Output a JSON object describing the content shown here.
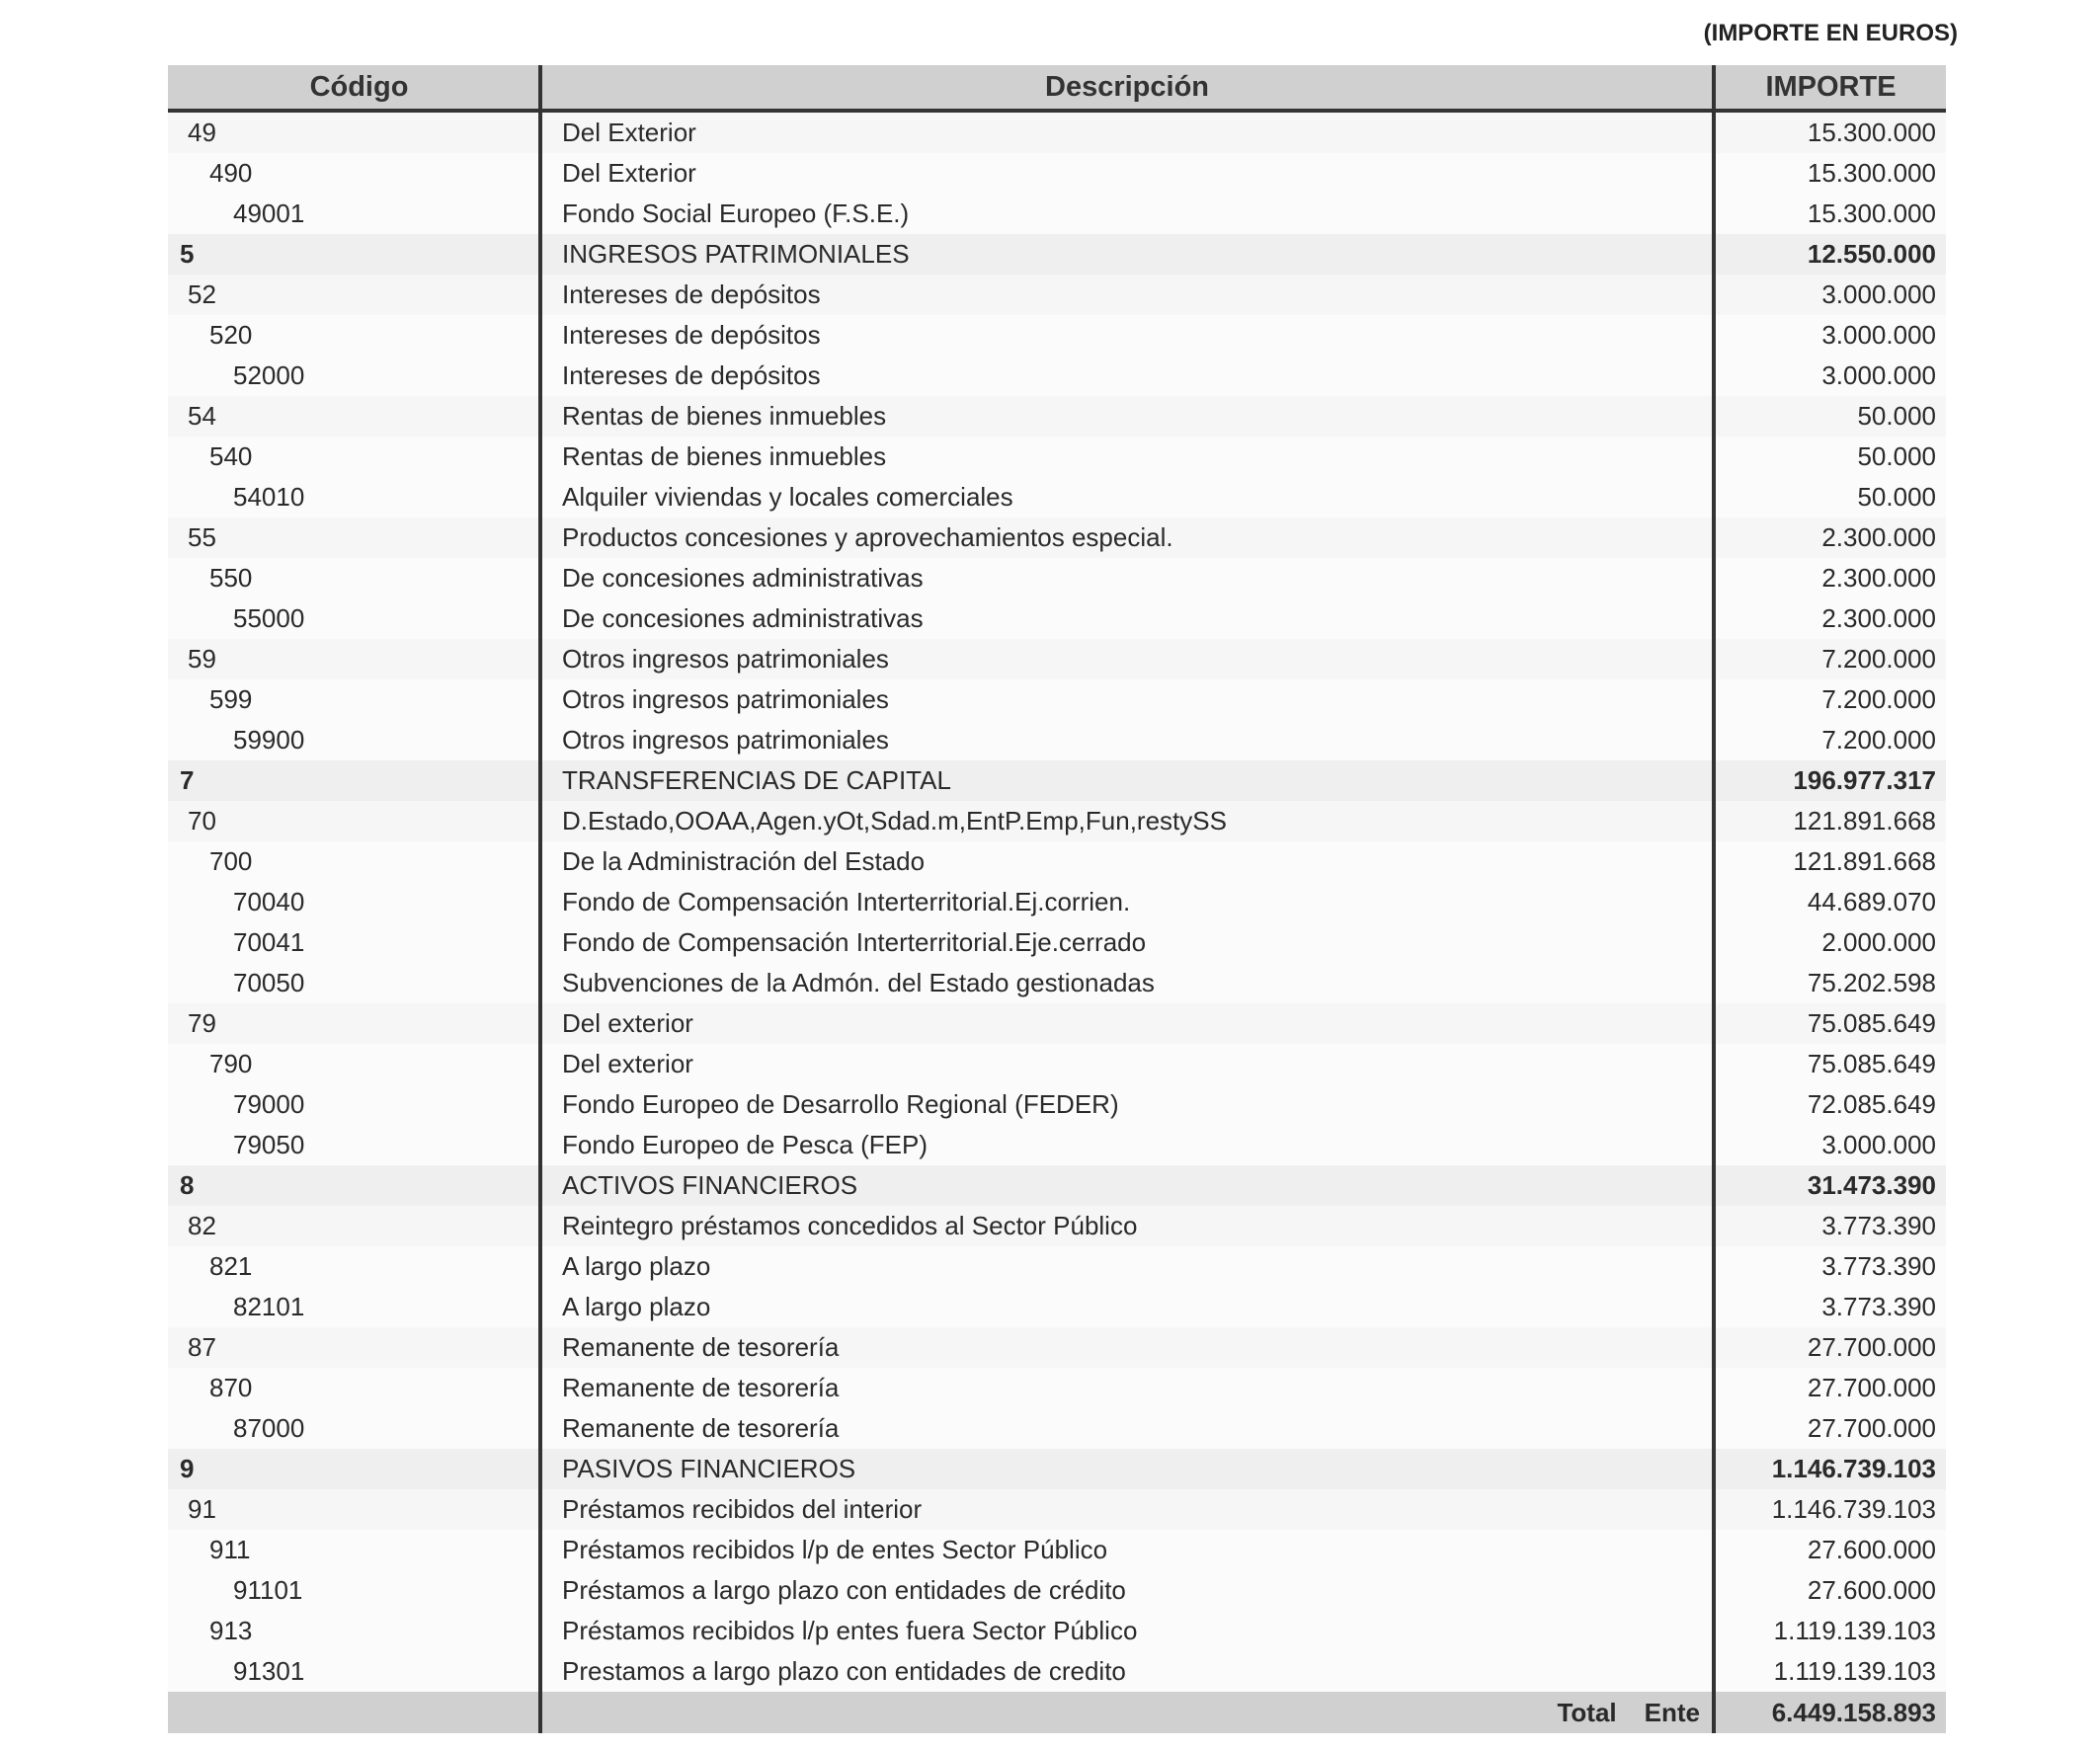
{
  "units_label": "(IMPORTE EN EUROS)",
  "columns": {
    "code": "Código",
    "description": "Descripción",
    "amount": "IMPORTE"
  },
  "rows": [
    {
      "level": 2,
      "code": "49",
      "description": "Del Exterior",
      "amount": "15.300.000"
    },
    {
      "level": 3,
      "code": "490",
      "description": "Del Exterior",
      "amount": "15.300.000"
    },
    {
      "level": 4,
      "code": "49001",
      "description": "Fondo Social Europeo (F.S.E.)",
      "amount": "15.300.000"
    },
    {
      "level": 1,
      "code": "5",
      "description": "INGRESOS PATRIMONIALES",
      "amount": "12.550.000"
    },
    {
      "level": 2,
      "code": "52",
      "description": "Intereses de depósitos",
      "amount": "3.000.000"
    },
    {
      "level": 3,
      "code": "520",
      "description": "Intereses de depósitos",
      "amount": "3.000.000"
    },
    {
      "level": 4,
      "code": "52000",
      "description": "Intereses de depósitos",
      "amount": "3.000.000"
    },
    {
      "level": 2,
      "code": "54",
      "description": "Rentas de bienes inmuebles",
      "amount": "50.000"
    },
    {
      "level": 3,
      "code": "540",
      "description": "Rentas de bienes inmuebles",
      "amount": "50.000"
    },
    {
      "level": 4,
      "code": "54010",
      "description": "Alquiler viviendas y locales comerciales",
      "amount": "50.000"
    },
    {
      "level": 2,
      "code": "55",
      "description": "Productos concesiones y aprovechamientos especial.",
      "amount": "2.300.000"
    },
    {
      "level": 3,
      "code": "550",
      "description": "De concesiones administrativas",
      "amount": "2.300.000"
    },
    {
      "level": 4,
      "code": "55000",
      "description": "De concesiones administrativas",
      "amount": "2.300.000"
    },
    {
      "level": 2,
      "code": "59",
      "description": "Otros ingresos patrimoniales",
      "amount": "7.200.000"
    },
    {
      "level": 3,
      "code": "599",
      "description": "Otros ingresos patrimoniales",
      "amount": "7.200.000"
    },
    {
      "level": 4,
      "code": "59900",
      "description": "Otros ingresos patrimoniales",
      "amount": "7.200.000"
    },
    {
      "level": 1,
      "code": "7",
      "description": "TRANSFERENCIAS DE CAPITAL",
      "amount": "196.977.317"
    },
    {
      "level": 2,
      "code": "70",
      "description": "D.Estado,OOAA,Agen.yOt,Sdad.m,EntP.Emp,Fun,restySS",
      "amount": "121.891.668"
    },
    {
      "level": 3,
      "code": "700",
      "description": "De la Administración del Estado",
      "amount": "121.891.668"
    },
    {
      "level": 4,
      "code": "70040",
      "description": "Fondo de Compensación Interterritorial.Ej.corrien.",
      "amount": "44.689.070"
    },
    {
      "level": 4,
      "code": "70041",
      "description": "Fondo de Compensación Interterritorial.Eje.cerrado",
      "amount": "2.000.000"
    },
    {
      "level": 4,
      "code": "70050",
      "description": "Subvenciones de la Admón. del Estado gestionadas",
      "amount": "75.202.598"
    },
    {
      "level": 2,
      "code": "79",
      "description": "Del exterior",
      "amount": "75.085.649"
    },
    {
      "level": 3,
      "code": "790",
      "description": "Del exterior",
      "amount": "75.085.649"
    },
    {
      "level": 4,
      "code": "79000",
      "description": "Fondo Europeo de Desarrollo Regional (FEDER)",
      "amount": "72.085.649"
    },
    {
      "level": 4,
      "code": "79050",
      "description": "Fondo Europeo de Pesca (FEP)",
      "amount": "3.000.000"
    },
    {
      "level": 1,
      "code": "8",
      "description": "ACTIVOS FINANCIEROS",
      "amount": "31.473.390"
    },
    {
      "level": 2,
      "code": "82",
      "description": "Reintegro préstamos concedidos al Sector Público",
      "amount": "3.773.390"
    },
    {
      "level": 3,
      "code": "821",
      "description": "A largo plazo",
      "amount": "3.773.390"
    },
    {
      "level": 4,
      "code": "82101",
      "description": "A largo plazo",
      "amount": "3.773.390"
    },
    {
      "level": 2,
      "code": "87",
      "description": "Remanente de tesorería",
      "amount": "27.700.000"
    },
    {
      "level": 3,
      "code": "870",
      "description": "Remanente de tesorería",
      "amount": "27.700.000"
    },
    {
      "level": 4,
      "code": "87000",
      "description": "Remanente de tesorería",
      "amount": "27.700.000"
    },
    {
      "level": 1,
      "code": "9",
      "description": "PASIVOS FINANCIEROS",
      "amount": "1.146.739.103"
    },
    {
      "level": 2,
      "code": "91",
      "description": "Préstamos recibidos del interior",
      "amount": "1.146.739.103"
    },
    {
      "level": 3,
      "code": "911",
      "description": "Préstamos recibidos l/p de entes Sector Público",
      "amount": "27.600.000"
    },
    {
      "level": 4,
      "code": "91101",
      "description": "Préstamos a largo plazo con entidades de crédito",
      "amount": "27.600.000"
    },
    {
      "level": 3,
      "code": "913",
      "description": "Préstamos recibidos l/p entes fuera Sector Público",
      "amount": "1.119.139.103"
    },
    {
      "level": 4,
      "code": "91301",
      "description": "Prestamos a largo plazo con entidades de credito",
      "amount": "1.119.139.103"
    }
  ],
  "total": {
    "label_1": "Total",
    "label_2": "Ente",
    "amount": "6.449.158.893"
  }
}
